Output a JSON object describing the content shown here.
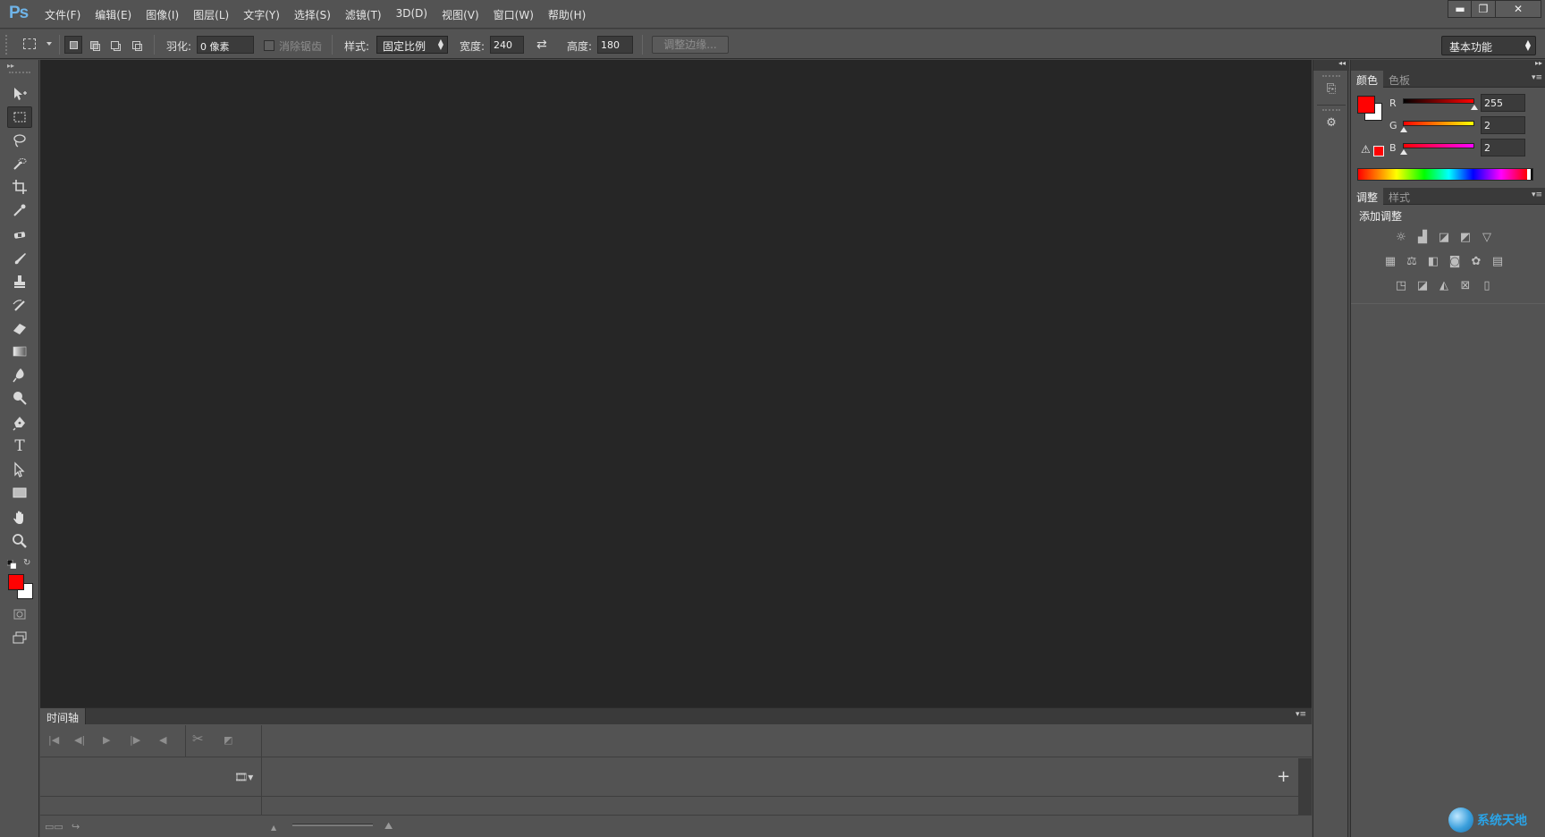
{
  "app": {
    "logo": "Ps",
    "menu": [
      "文件(F)",
      "编辑(E)",
      "图像(I)",
      "图层(L)",
      "文字(Y)",
      "选择(S)",
      "滤镜(T)",
      "3D(D)",
      "视图(V)",
      "窗口(W)",
      "帮助(H)"
    ],
    "window_controls": {
      "minimize": "▬",
      "maximize": "❐",
      "close": "✕"
    }
  },
  "options_bar": {
    "feather_label": "羽化:",
    "feather_value": "0 像素",
    "antialias_label": "消除锯齿",
    "style_label": "样式:",
    "style_value": "固定比例",
    "width_label": "宽度:",
    "width_value": "240",
    "height_label": "高度:",
    "height_value": "180",
    "refine_edge": "调整边缘...",
    "workspace": "基本功能"
  },
  "toolbar": {
    "active_tool": "rectangular-marquee",
    "foreground_color": "#ff0202",
    "background_color": "#ffffff"
  },
  "timeline": {
    "tab": "时间轴",
    "add_symbol": "+"
  },
  "color_panel": {
    "tabs": [
      "颜色",
      "色板"
    ],
    "channels": [
      {
        "label": "R",
        "value": "255",
        "fraction": 1.0
      },
      {
        "label": "G",
        "value": "2",
        "fraction": 0.008
      },
      {
        "label": "B",
        "value": "2",
        "fraction": 0.008
      }
    ],
    "foreground": "#ff0202",
    "background": "#ffffff"
  },
  "adjustments_panel": {
    "tabs": [
      "调整",
      "样式"
    ],
    "title": "添加调整",
    "icons_row1": [
      "brightness-icon",
      "levels-icon",
      "curves-icon",
      "exposure-icon",
      "vibrance-icon"
    ],
    "icons_row2": [
      "hue-saturation-icon",
      "color-balance-icon",
      "black-white-icon",
      "photo-filter-icon",
      "channel-mixer-icon",
      "color-lookup-icon"
    ],
    "icons_row3": [
      "invert-icon",
      "posterize-icon",
      "threshold-icon",
      "selective-color-icon",
      "gradient-map-icon"
    ]
  },
  "watermark": {
    "text": "系统天地"
  }
}
